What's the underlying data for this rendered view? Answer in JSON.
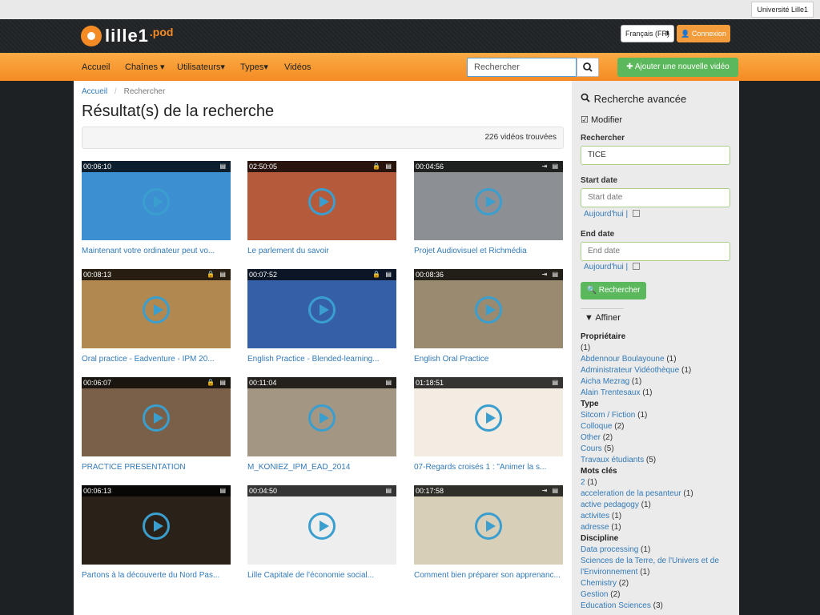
{
  "top_link": "Université Lille1",
  "logo": {
    "text": "lille1",
    "suffix": ".pod"
  },
  "header": {
    "language": "Français (FR)",
    "login": "Connexion"
  },
  "nav": {
    "home": "Accueil",
    "channels": "Chaînes",
    "users": "Utilisateurs",
    "types": "Types",
    "videos": "Vidéos"
  },
  "search": {
    "placeholder": "Rechercher"
  },
  "add_video": "Ajouter une nouvelle vidéo",
  "breadcrumb": {
    "home": "Accueil",
    "sep": "/",
    "current": "Rechercher"
  },
  "page_title": "Résultat(s) de la recherche",
  "result_count": "226 vidéos trouvées",
  "videos": [
    {
      "duration": "00:06:10",
      "title": "Maintenant votre ordinateur peut vo...",
      "icons": "▤",
      "bg": "#3c8fd0"
    },
    {
      "duration": "02:50:05",
      "title": "Le parlement du savoir",
      "icons": "🔒 ▤",
      "bg": "#b55a3a"
    },
    {
      "duration": "00:04:56",
      "title": "Projet Audiovisuel et Richmédia",
      "icons": "⇥ ▤",
      "bg": "#8c9094"
    },
    {
      "duration": "00:08:13",
      "title": "Oral practice - Eadventure - IPM 20...",
      "icons": "🔒 ▤",
      "bg": "#b08850"
    },
    {
      "duration": "00:07:52",
      "title": "English Practice - Blended-learning...",
      "icons": "🔒 ▤",
      "bg": "#3560a8"
    },
    {
      "duration": "00:08:36",
      "title": "English Oral Practice",
      "icons": "⇥ ▤",
      "bg": "#9a8a70"
    },
    {
      "duration": "00:06:07",
      "title": "PRACTICE PRESENTATION",
      "icons": "🔒 ▤",
      "bg": "#7a6048"
    },
    {
      "duration": "00:11:04",
      "title": "M_KONIEZ_IPM_EAD_2014",
      "icons": "▤",
      "bg": "#a39683"
    },
    {
      "duration": "01:18:51",
      "title": "07-Regards croisés 1 : \"Animer la s...",
      "icons": "▤",
      "bg": "#f3ece2"
    },
    {
      "duration": "00:06:13",
      "title": "Partons à la découverte du Nord Pas...",
      "icons": "▤",
      "bg": "#2a2218"
    },
    {
      "duration": "00:04:50",
      "title": "Lille Capitale de l'économie social...",
      "icons": "▤",
      "bg": "#eeeeee"
    },
    {
      "duration": "00:17:58",
      "title": "Comment bien préparer son apprenanc...",
      "icons": "⇥ ▤",
      "bg": "#d8cfb8"
    }
  ],
  "sidebar": {
    "title": "Recherche avancée",
    "modify": "Modifier",
    "search_label": "Rechercher",
    "search_value": "TICE",
    "start_label": "Start date",
    "start_placeholder": "Start date",
    "end_label": "End date",
    "end_placeholder": "End date",
    "today": "Aujourd'hui",
    "search_button": "Rechercher",
    "refine": "Affiner",
    "facets": [
      {
        "heading": "Propriétaire",
        "items": [
          {
            "label": "",
            "count": "(1)"
          },
          {
            "label": "Abdennour Boulayoune",
            "count": "(1)"
          },
          {
            "label": "Administrateur Vidéothèque",
            "count": "(1)"
          },
          {
            "label": "Aicha Mezrag",
            "count": "(1)"
          },
          {
            "label": "Alain Trentesaux",
            "count": "(1)"
          }
        ]
      },
      {
        "heading": "Type",
        "items": [
          {
            "label": "Sitcom / Fiction",
            "count": "(1)"
          },
          {
            "label": "Colloque",
            "count": "(2)"
          },
          {
            "label": "Other",
            "count": "(2)"
          },
          {
            "label": "Cours",
            "count": "(5)"
          },
          {
            "label": "Travaux étudiants",
            "count": "(5)"
          }
        ]
      },
      {
        "heading": "Mots clés",
        "items": [
          {
            "label": "2",
            "count": "(1)"
          },
          {
            "label": "acceleration de la pesanteur",
            "count": "(1)"
          },
          {
            "label": "active pedagogy",
            "count": "(1)"
          },
          {
            "label": "activites",
            "count": "(1)"
          },
          {
            "label": "adresse",
            "count": "(1)"
          }
        ]
      },
      {
        "heading": "Discipline",
        "items": [
          {
            "label": "Data processing",
            "count": "(1)"
          },
          {
            "label": "Sciences de la Terre, de l'Univers et de",
            "count": ""
          },
          {
            "label": "l'Environnement",
            "count": "(1)"
          },
          {
            "label": "Chemistry",
            "count": "(2)"
          },
          {
            "label": "Gestion",
            "count": "(2)"
          },
          {
            "label": "Education Sciences",
            "count": "(3)"
          }
        ]
      }
    ]
  }
}
